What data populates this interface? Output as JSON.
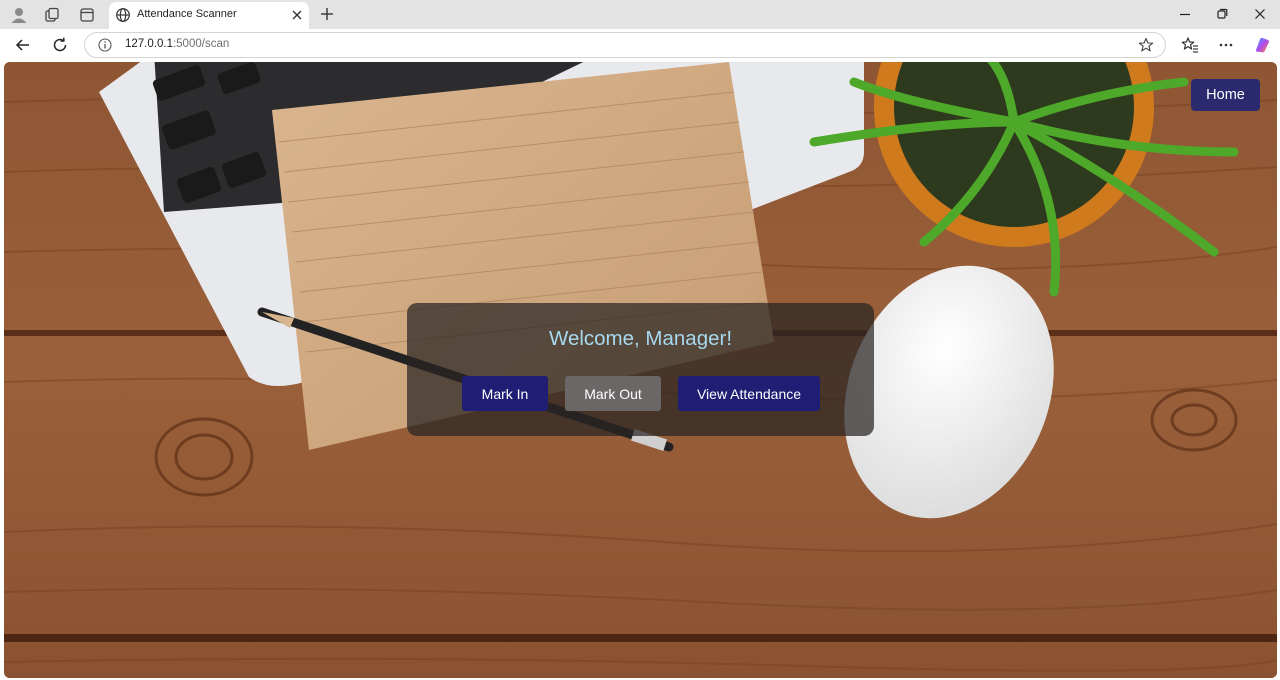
{
  "browser": {
    "tab_title": "Attendance Scanner",
    "url_host": "127.0.0.1",
    "url_rest": ":5000/scan"
  },
  "page": {
    "nav": {
      "home_label": "Home"
    },
    "panel": {
      "welcome": "Welcome, Manager!",
      "mark_in_label": "Mark In",
      "mark_out_label": "Mark Out",
      "view_attendance_label": "View Attendance"
    }
  },
  "colors": {
    "accent": "#1f1d74",
    "home_button": "#2b2a6f",
    "secondary_button": "#6b6766",
    "welcome_text": "#a6d8ee",
    "panel_overlay": "rgba(40,36,34,0.72)"
  },
  "icons": [
    "profile-icon",
    "collections-icon",
    "tab-actions-icon",
    "globe-icon",
    "close-icon",
    "plus-icon",
    "minimize-icon",
    "maximize-icon",
    "back-icon",
    "refresh-icon",
    "info-icon",
    "star-icon",
    "favorites-icon",
    "more-icon",
    "copilot-icon"
  ]
}
